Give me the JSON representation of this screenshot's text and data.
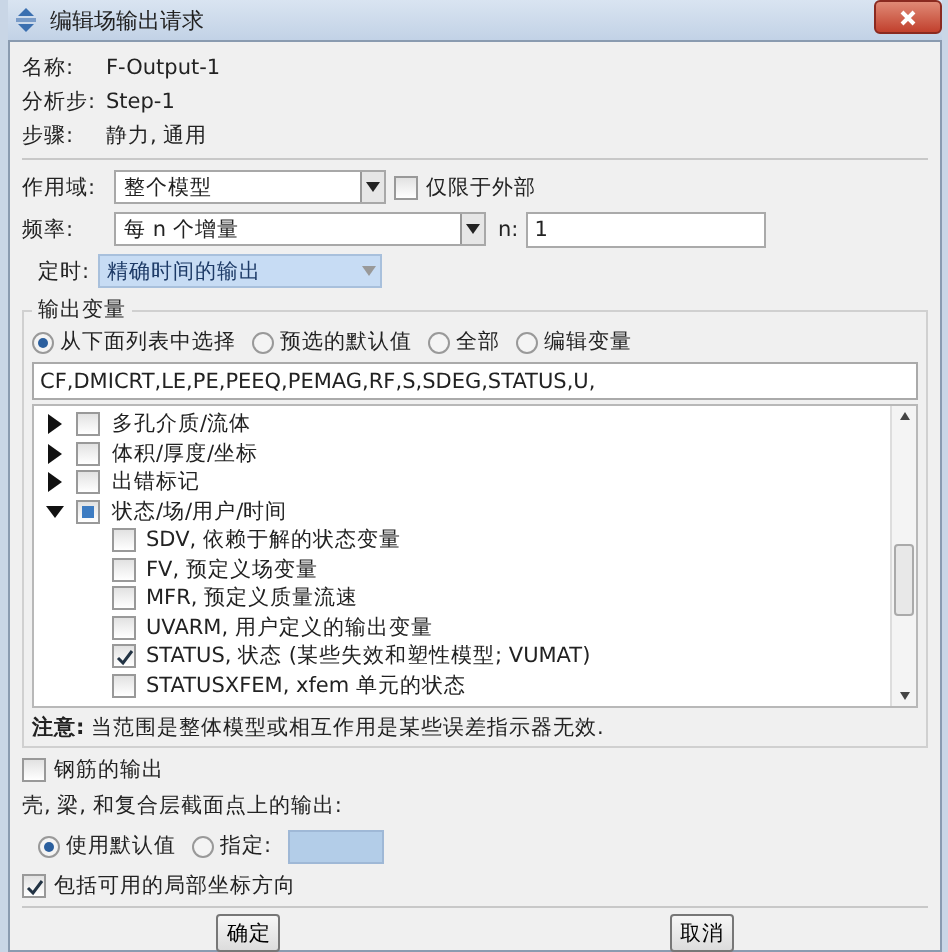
{
  "window": {
    "title": "编辑场输出请求"
  },
  "info": [
    {
      "label": "名称:",
      "value": "F-Output-1"
    },
    {
      "label": "分析步:",
      "value": "Step-1"
    },
    {
      "label": "步骤:",
      "value": "静力, 通用"
    }
  ],
  "domain": {
    "label": "作用域:",
    "value": "整个模型",
    "exterior": {
      "label": "仅限于外部",
      "checked": false
    }
  },
  "frequency": {
    "label": "频率:",
    "value": "每 n 个增量",
    "n_label": "n:",
    "n_value": "1"
  },
  "timing": {
    "label": "定时:",
    "value": "精确时间的输出"
  },
  "output_variables": {
    "title": "输出变量",
    "sources": [
      {
        "label": "从下面列表中选择",
        "selected": true
      },
      {
        "label": "预选的默认值",
        "selected": false
      },
      {
        "label": "全部",
        "selected": false
      },
      {
        "label": "编辑变量",
        "selected": false
      }
    ],
    "variables": "CF,DMICRT,LE,PE,PEEQ,PEMAG,RF,S,SDEG,STATUS,U,",
    "tree": [
      {
        "label": "多孔介质/流体",
        "expanded": false,
        "checked": false,
        "partial": false
      },
      {
        "label": "体积/厚度/坐标",
        "expanded": false,
        "checked": false,
        "partial": false
      },
      {
        "label": "出错标记",
        "expanded": false,
        "checked": false,
        "partial": false
      },
      {
        "label": "状态/场/用户/时间",
        "expanded": true,
        "checked": false,
        "partial": true,
        "children": [
          {
            "label": "SDV, 依赖于解的状态变量",
            "checked": false
          },
          {
            "label": "FV, 预定义场变量",
            "checked": false
          },
          {
            "label": "MFR, 预定义质量流速",
            "checked": false
          },
          {
            "label": "UVARM, 用户定义的输出变量",
            "checked": false
          },
          {
            "label": "STATUS, 状态 (某些失效和塑性模型; VUMAT)",
            "checked": true
          },
          {
            "label": "STATUSXFEM, xfem 单元的状态",
            "checked": false
          }
        ]
      }
    ],
    "note": "**注意:** 当范围是整体模型或相互作用是某些误差指示器无效."
  },
  "rebar": {
    "label": "钢筋的输出",
    "checked": false
  },
  "section_points": {
    "label": "壳, 梁, 和复合层截面点上的输出:",
    "options": [
      {
        "label": "使用默认值",
        "selected": true
      },
      {
        "label": "指定:",
        "selected": false
      }
    ]
  },
  "local_coords": {
    "label": "包括可用的局部坐标方向",
    "checked": true
  },
  "buttons": [
    "确定",
    "取消"
  ]
}
